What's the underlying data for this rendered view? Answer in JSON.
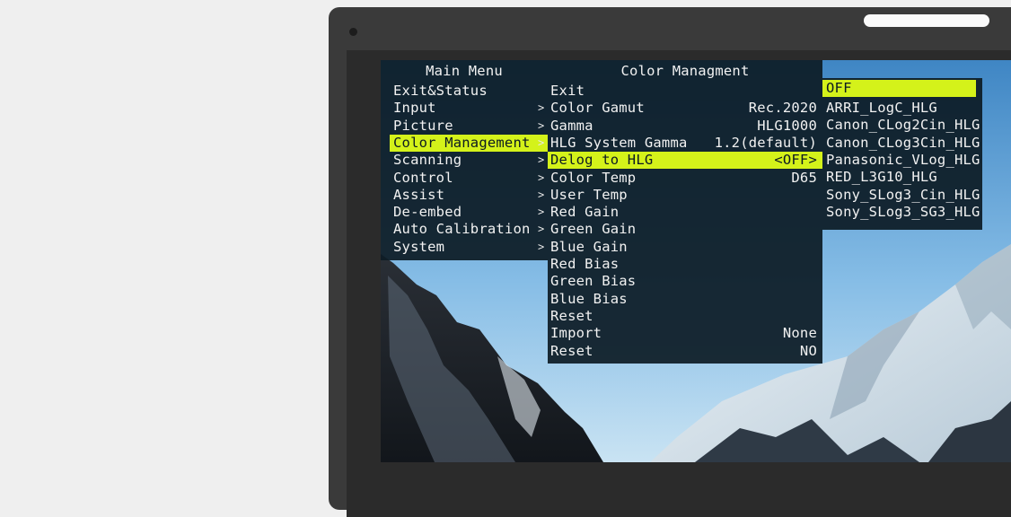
{
  "main_menu": {
    "title": "Main Menu",
    "items": [
      "Exit&Status",
      "Input",
      "Picture",
      "Color Management",
      "Scanning",
      "Control",
      "Assist",
      "De-embed",
      "Auto Calibration",
      "System"
    ],
    "selected_index": 3
  },
  "color_menu": {
    "title": "Color Managment",
    "items": [
      {
        "label": "Exit",
        "value": ""
      },
      {
        "label": "Color Gamut",
        "value": "Rec.2020"
      },
      {
        "label": "Gamma",
        "value": "HLG1000"
      },
      {
        "label": "HLG System Gamma",
        "value": "1.2(default)"
      },
      {
        "label": "Delog to HLG",
        "value": "<OFF>"
      },
      {
        "label": "Color Temp",
        "value": "D65"
      },
      {
        "label": "User Temp",
        "value": ""
      },
      {
        "label": "Red Gain",
        "value": ""
      },
      {
        "label": "Green Gain",
        "value": ""
      },
      {
        "label": "Blue Gain",
        "value": ""
      },
      {
        "label": "Red Bias",
        "value": ""
      },
      {
        "label": "Green Bias",
        "value": ""
      },
      {
        "label": "Blue Bias",
        "value": ""
      },
      {
        "label": "Reset",
        "value": ""
      },
      {
        "label": "Import",
        "value": "None"
      },
      {
        "label": "Reset",
        "value": "NO"
      }
    ],
    "selected_index": 4,
    "arrow_glyph": ">"
  },
  "delog_options": {
    "items": [
      "OFF",
      "ARRI_LogC_HLG",
      "Canon_CLog2Cin_HLG",
      "Canon_CLog3Cin_HLG",
      "Panasonic_VLog_HLG",
      "RED_L3G10_HLG",
      "Sony_SLog3_Cin_HLG",
      "Sony_SLog3_SG3_HLG"
    ],
    "selected_index": 0
  },
  "colors": {
    "highlight": "#d4f21a",
    "panel_bg": "#0d1c26",
    "bezel": "#3a3a3a",
    "page_bg": "#efefef"
  }
}
